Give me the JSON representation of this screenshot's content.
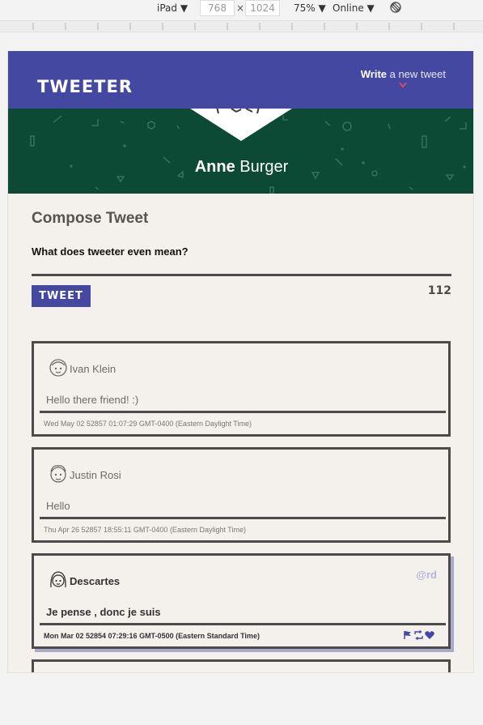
{
  "devtools": {
    "device": "iPad ▼",
    "width": "768",
    "times": "×",
    "height": "1024",
    "zoom": "75% ▼",
    "network": "Online ▼",
    "icons": [
      "rotate-icon"
    ]
  },
  "nav": {
    "logo": "TWEETER",
    "write_strong": "Write",
    "write_rest": " a new tweet",
    "arrow_icon": "chevron-down-icon"
  },
  "profile": {
    "first_name": "Anne",
    "last_name": " Burger",
    "avatar_icon": "user-avatar-icon"
  },
  "compose": {
    "title": "Compose Tweet",
    "input_value": "What does tweeter even mean?",
    "button_label": "TWEET",
    "counter": "112"
  },
  "tweets": [
    {
      "name": "Ivan Klein",
      "body": "Hello there friend! :)",
      "date": "Wed May 02 52857 01:07:29 GMT-0400 (Eastern Daylight Time)",
      "handle": "",
      "avatar_icon": "user-avatar-icon"
    },
    {
      "name": "Justin Rosi",
      "body": "Hello",
      "date": "Thu Apr 26 52857 18:55:11 GMT-0400 (Eastern Daylight Time)",
      "handle": "",
      "avatar_icon": "user-avatar-icon"
    },
    {
      "name": "Descartes",
      "body": "Je pense , donc je suis",
      "date": "Mon Mar 02 52854 07:29:16 GMT-0500 (Eastern Standard Time)",
      "handle": "@rd",
      "avatar_icon": "user-avatar-icon",
      "action_icons": [
        "flag-icon",
        "retweet-icon",
        "heart-icon"
      ]
    }
  ],
  "colors": {
    "nav": "#4448a1",
    "banner": "#0d4a36",
    "background": "#f4f1ec",
    "border": "#4b4b4b",
    "like": "#d14b6a"
  }
}
